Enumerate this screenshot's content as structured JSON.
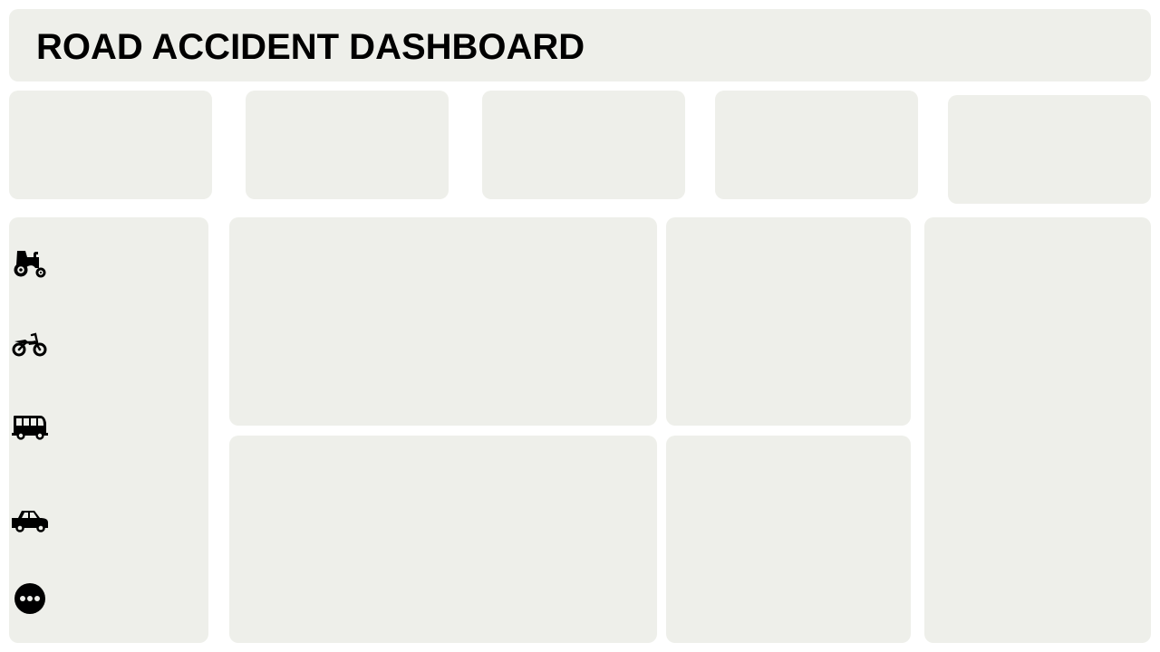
{
  "header": {
    "title": "ROAD ACCIDENT DASHBOARD"
  },
  "kpi_cards": [
    {
      "id": "kpi-1",
      "content": ""
    },
    {
      "id": "kpi-2",
      "content": ""
    },
    {
      "id": "kpi-3",
      "content": ""
    },
    {
      "id": "kpi-4",
      "content": ""
    },
    {
      "id": "kpi-5",
      "content": ""
    }
  ],
  "sidebar": {
    "icons": [
      "tractor-icon",
      "motorcycle-icon",
      "bus-icon",
      "car-icon",
      "more-icon"
    ]
  },
  "chart_panels": [
    "chart-a",
    "chart-b",
    "chart-c",
    "chart-d",
    "chart-e"
  ],
  "colors": {
    "panel_bg": "#eeefea",
    "page_bg": "#ffffff",
    "text": "#000000"
  }
}
